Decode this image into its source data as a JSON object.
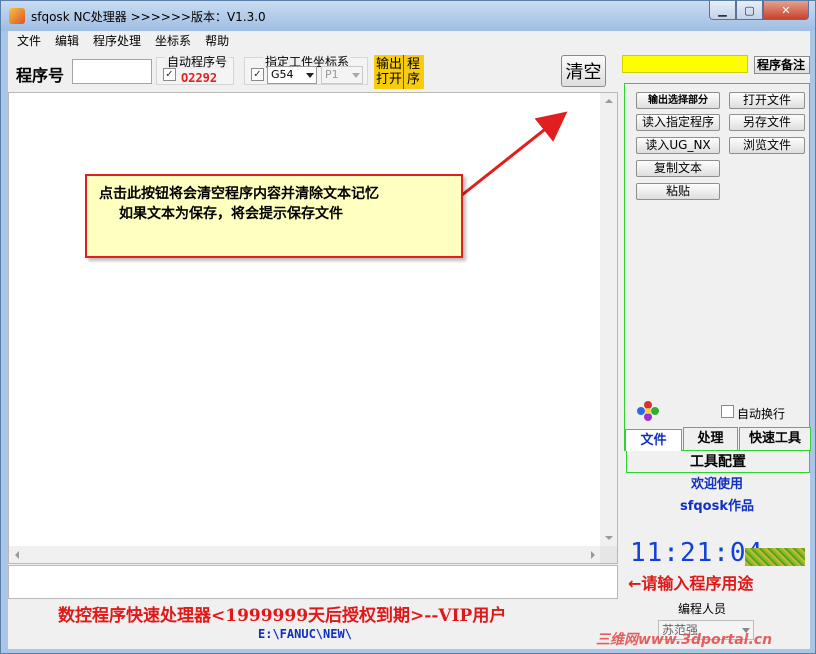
{
  "window": {
    "title": "sfqosk NC处理器  >>>>>>版本：V1.3.0",
    "min_glyph": "▁",
    "max_glyph": "▢",
    "close_glyph": "✕"
  },
  "menu": [
    "文件",
    "编辑",
    "程序处理",
    "坐标系",
    "帮助"
  ],
  "toolbar": {
    "program_label": "程序号",
    "program_value": "",
    "auto_group_title": "自动程序号",
    "auto_checked": "✓",
    "auto_number": "O2292",
    "coord_group_title": "指定工件坐标系",
    "coord_checked": "✓",
    "coord_select": "G54",
    "coord_sub_select": "P1",
    "output_open_col1_top": "输出",
    "output_open_col1_bottom": "打开",
    "output_open_col2_top": "程",
    "output_open_col2_bottom": "序",
    "clear_label": "清空"
  },
  "callout": {
    "line1": "点击此按钮将会清空程序内容并清除文本记忆",
    "line2": "如果文本为保存，将会提示保存文件"
  },
  "status": {
    "main": "数控程序快速处理器<1999999天后授权到期>--VIP用户",
    "path": "E:\\FANUC\\NEW\\"
  },
  "right_panel": {
    "note_button": "程序备注",
    "buttons_left": [
      "输出选择部分",
      "读入指定程序",
      "读入UG_NX",
      "复制文本",
      "粘贴"
    ],
    "buttons_right": [
      "打开文件",
      "另存文件",
      "浏览文件"
    ],
    "auto_wrap_label": "自动换行",
    "tabs": [
      "文件",
      "处理",
      "快速工具"
    ],
    "tools_config": "工具配置",
    "welcome_line1": "欢迎使用",
    "welcome_line2": "sfqosk作品",
    "clock": "11:21:04",
    "hint": "←请输入程序用途",
    "programmer_label": "编程人员",
    "programmer_value": "苏范强",
    "watermark": "三维网www.3dportal.cn"
  },
  "colors": {
    "accent_yellow": "#f8cc0e",
    "highlight_yellow": "#ffff00",
    "status_red": "#e01818",
    "path_blue": "#1030c0",
    "frame_green": "#2fd32f"
  }
}
